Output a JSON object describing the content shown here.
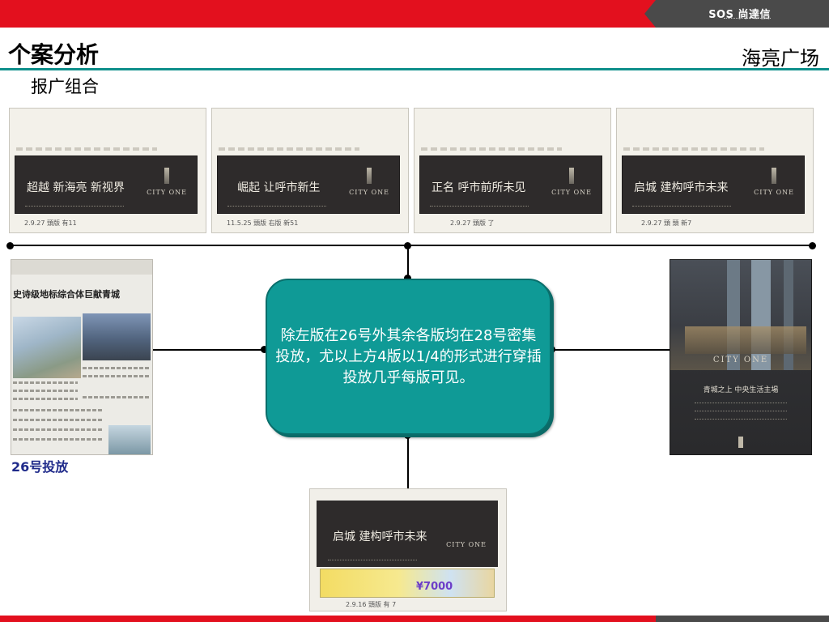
{
  "header": {
    "brand_logo": "SOS 尚達信",
    "title": "个案分析",
    "project": "海亮广场",
    "section": "报广组合",
    "accent_red": "#e3101e",
    "accent_teal": "#0e8f8b"
  },
  "top_ads": [
    {
      "slogan": "超越 新海亮 新视界",
      "brand": "CITY ONE",
      "handnote": "2.9.27 頭版 有11"
    },
    {
      "slogan": "崛起 让呼市新生",
      "brand": "CITY ONE",
      "handnote": "11.5.25 頭版 右版 新51"
    },
    {
      "slogan": "正名 呼市前所未见",
      "brand": "CITY ONE",
      "handnote": "2.9.27 頭版 了"
    },
    {
      "slogan": "启城 建构呼市未来",
      "brand": "CITY ONE",
      "handnote": "2.9.27 頭 頭 新7"
    }
  ],
  "left_page": {
    "headline": "史诗级地标综合体巨献青城",
    "caption": "26号投放"
  },
  "center_note": {
    "text": "除左版在26号外其余各版均在28号密集投放，尤以上方4版以1/4的形式进行穿插投放几乎每版可见。",
    "fill_color": "#0f9a96"
  },
  "right_page": {
    "brand": "CITY ONE",
    "slogan": "青城之上 中央生活主場"
  },
  "bottom_ad": {
    "slogan": "启城 建构呼市未来",
    "brand": "CITY ONE",
    "promo_price": "¥7000",
    "handnote": "2.9.16 頭版 有 7"
  }
}
